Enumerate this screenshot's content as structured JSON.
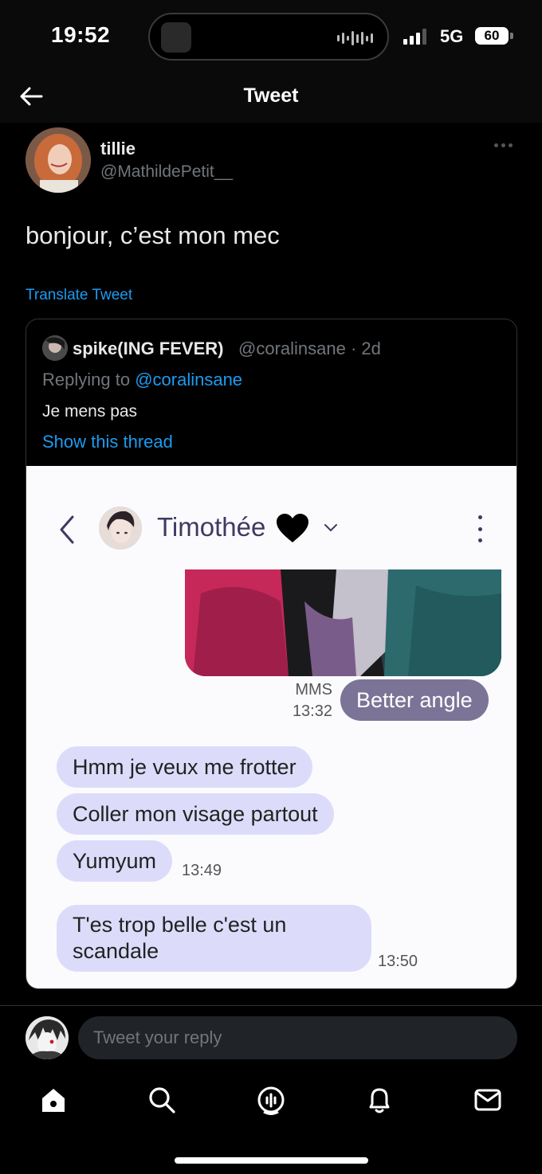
{
  "status_bar": {
    "time": "19:52",
    "network": "5G",
    "battery": "60"
  },
  "header": {
    "title": "Tweet",
    "back_icon": "arrow-left-icon"
  },
  "tweet": {
    "author_name": "tillie",
    "author_handle": "@MathildePetit__",
    "text": "bonjour, c’est mon mec",
    "translate_label": "Translate Tweet"
  },
  "quoted_tweet": {
    "author_name": "spike(ING FEVER)",
    "author_handle": "@coralinsane · 2d",
    "replying_prefix": "Replying to ",
    "replying_handle": "@coralinsane",
    "text": "Je mens pas",
    "show_thread": "Show this thread"
  },
  "chat": {
    "contact_name": "Timothée",
    "outgoing_label": "MMS",
    "outgoing_time": "13:32",
    "outgoing_text": "Better angle",
    "incoming": [
      {
        "text": "Hmm je veux me frotter"
      },
      {
        "text": "Coller mon visage partout"
      },
      {
        "text": "Yumyum",
        "time": "13:49"
      },
      {
        "text": "T'es trop belle c'est un scandale",
        "line1": "T'es trop belle c'est un",
        "line2": "scandale",
        "time": "13:50"
      }
    ],
    "colors": {
      "outgoing_bubble": "#7c7497",
      "incoming_bubble": "#dcdcfa",
      "name": "#3d3a62"
    }
  },
  "reply": {
    "placeholder": "Tweet your reply"
  },
  "tab_bar": {
    "icons": [
      "home-icon",
      "search-icon",
      "spaces-icon",
      "notifications-icon",
      "messages-icon"
    ]
  },
  "theme": {
    "link": "#1d9bf0",
    "muted": "#71767b",
    "text": "#e7e9ea"
  }
}
